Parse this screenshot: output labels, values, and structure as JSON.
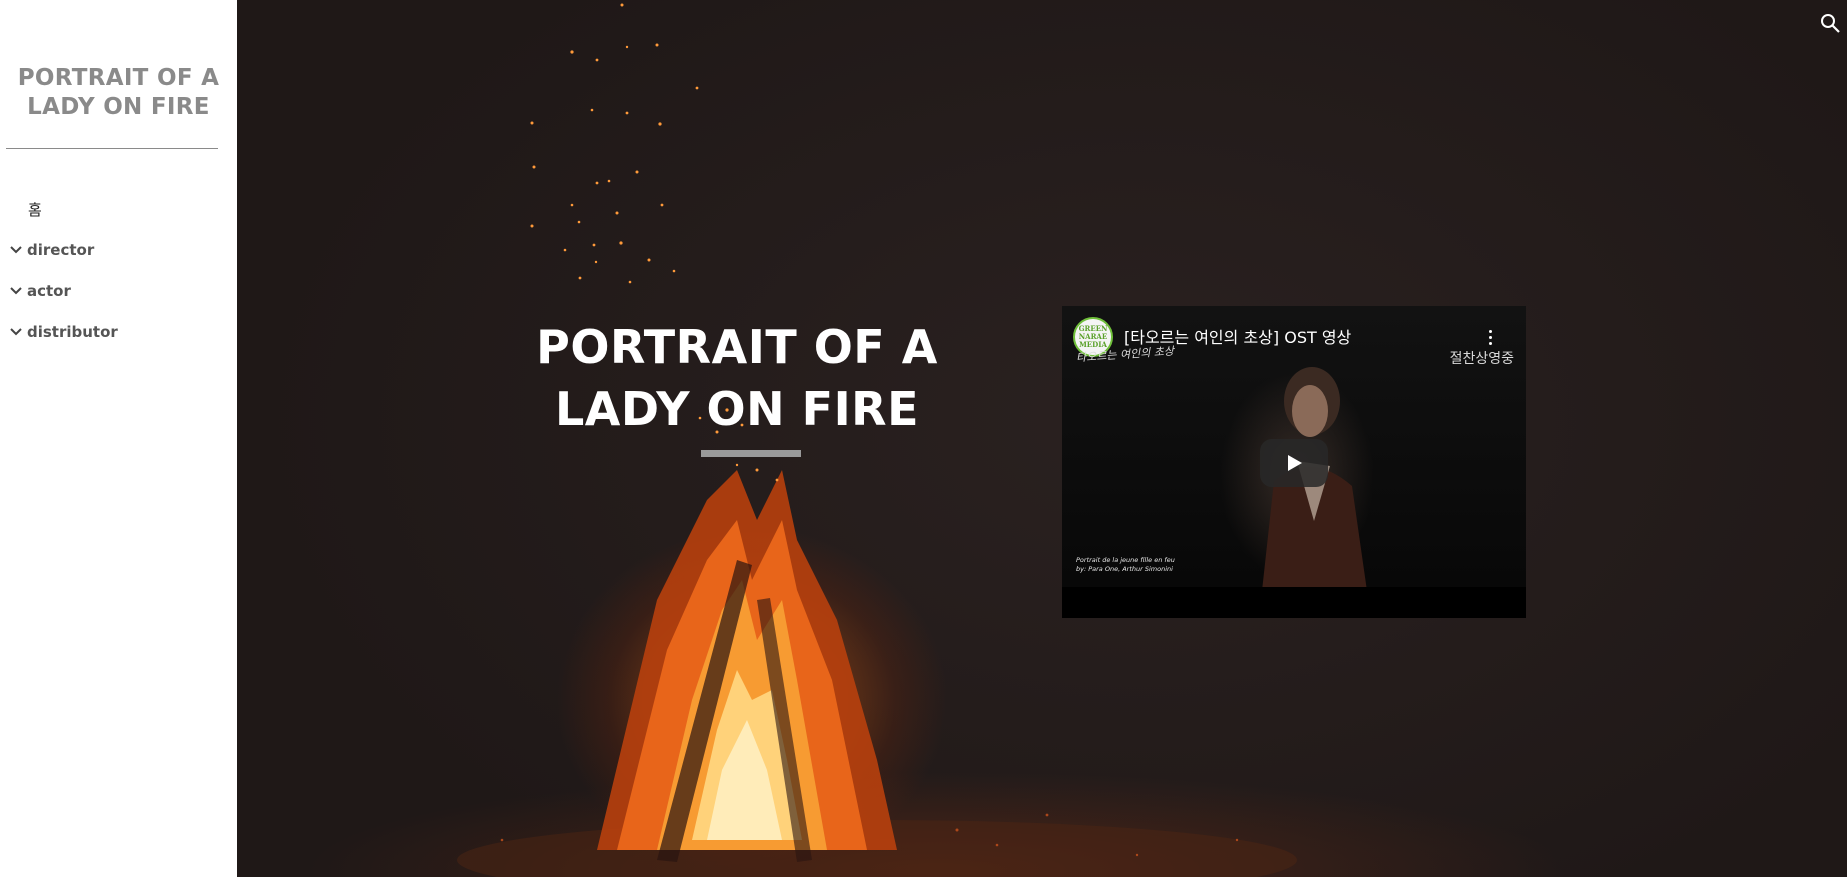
{
  "sidebar": {
    "title": "PORTRAIT OF A LADY ON FIRE",
    "items": [
      {
        "label": "홈",
        "expandable": false
      },
      {
        "label": "director",
        "expandable": true
      },
      {
        "label": "actor",
        "expandable": true
      },
      {
        "label": "distributor",
        "expandable": true
      }
    ]
  },
  "header": {
    "search_icon": "search-icon"
  },
  "hero": {
    "title": "PORTRAIT OF A LADY ON FIRE"
  },
  "video": {
    "channel_logo_text": "GREEN NARAE MEDIA",
    "title": "[타오르는 여인의 초상] OST 영상",
    "overlay_text": "절찬상영중",
    "script_text": "타오르는 여인의 초상",
    "caption_line1": "Portrait de la jeune fille en feu",
    "caption_line2": "by: Para One, Arthur Simonini",
    "play_icon": "play-icon",
    "menu_icon": "more-vert-icon"
  },
  "colors": {
    "sidebar_bg": "#ffffff",
    "sidebar_title": "#8a8a8a",
    "hero_bg": "#231b1a",
    "hero_title": "#ffffff",
    "accent_bar": "#9a9a9a"
  }
}
